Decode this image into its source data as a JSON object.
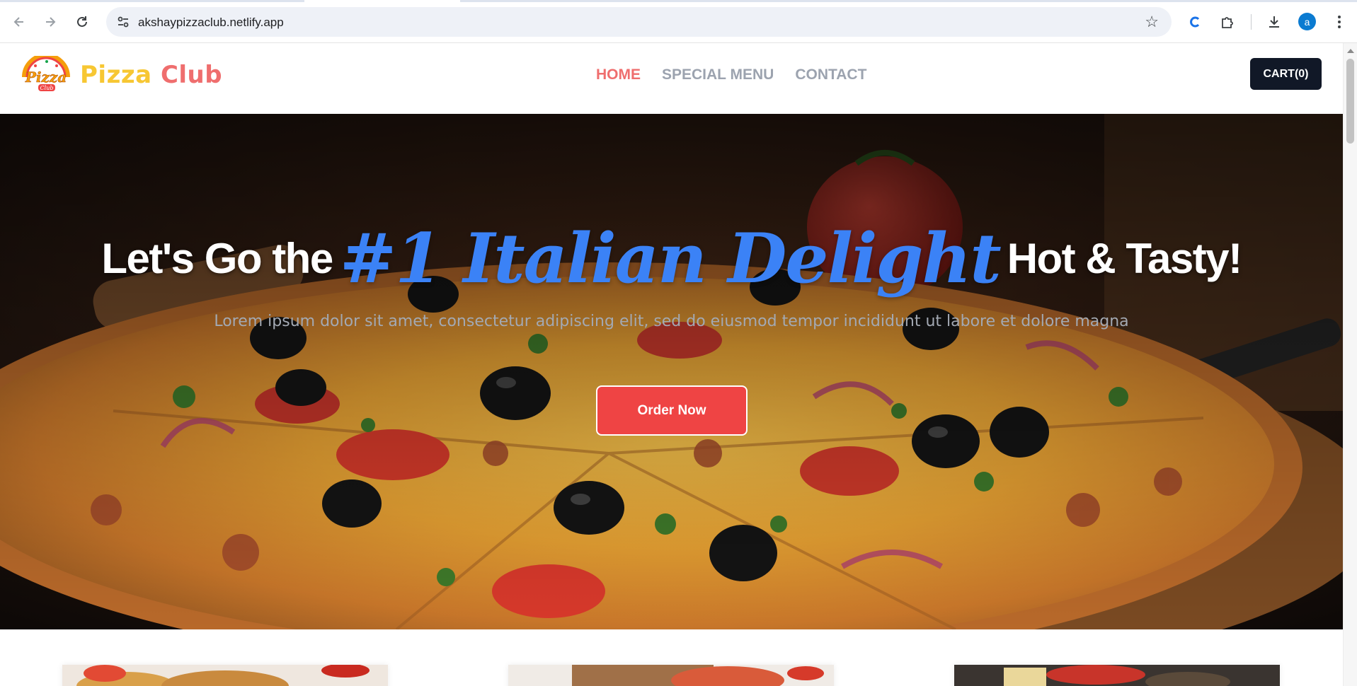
{
  "browser": {
    "url": "akshaypizzaclub.netlify.app",
    "avatar_letter": "a",
    "icons": [
      "back-icon",
      "forward-icon",
      "reload-icon",
      "site-info-icon",
      "bookmark-star-icon",
      "extension-c-icon",
      "extensions-puzzle-icon",
      "download-icon",
      "menu-dots-icon"
    ]
  },
  "header": {
    "brand_part1": "Pizza",
    "brand_part2": "Club",
    "logo_text": "Pizza",
    "logo_subtext": "Club",
    "nav": [
      {
        "label": "HOME",
        "active": true
      },
      {
        "label": "SPECIAL MENU",
        "active": false
      },
      {
        "label": "CONTACT",
        "active": false
      }
    ],
    "cart_label": "CART(0)"
  },
  "hero": {
    "title_before": "Let's Go the",
    "title_script": "#1 Italian Delight",
    "title_after": "Hot & Tasty!",
    "subtitle": "Lorem ipsum dolor sit amet, consectetur adipiscing elit, sed do eiusmod tempor incididunt ut labore et dolore magna",
    "cta_label": "Order Now"
  },
  "colors": {
    "brand_yellow": "#f7c733",
    "brand_red": "#ef6e6e",
    "accent_blue": "#3b82f6",
    "button_red": "#ef4444",
    "cart_dark": "#111827",
    "nav_gray": "#9ca3af"
  }
}
